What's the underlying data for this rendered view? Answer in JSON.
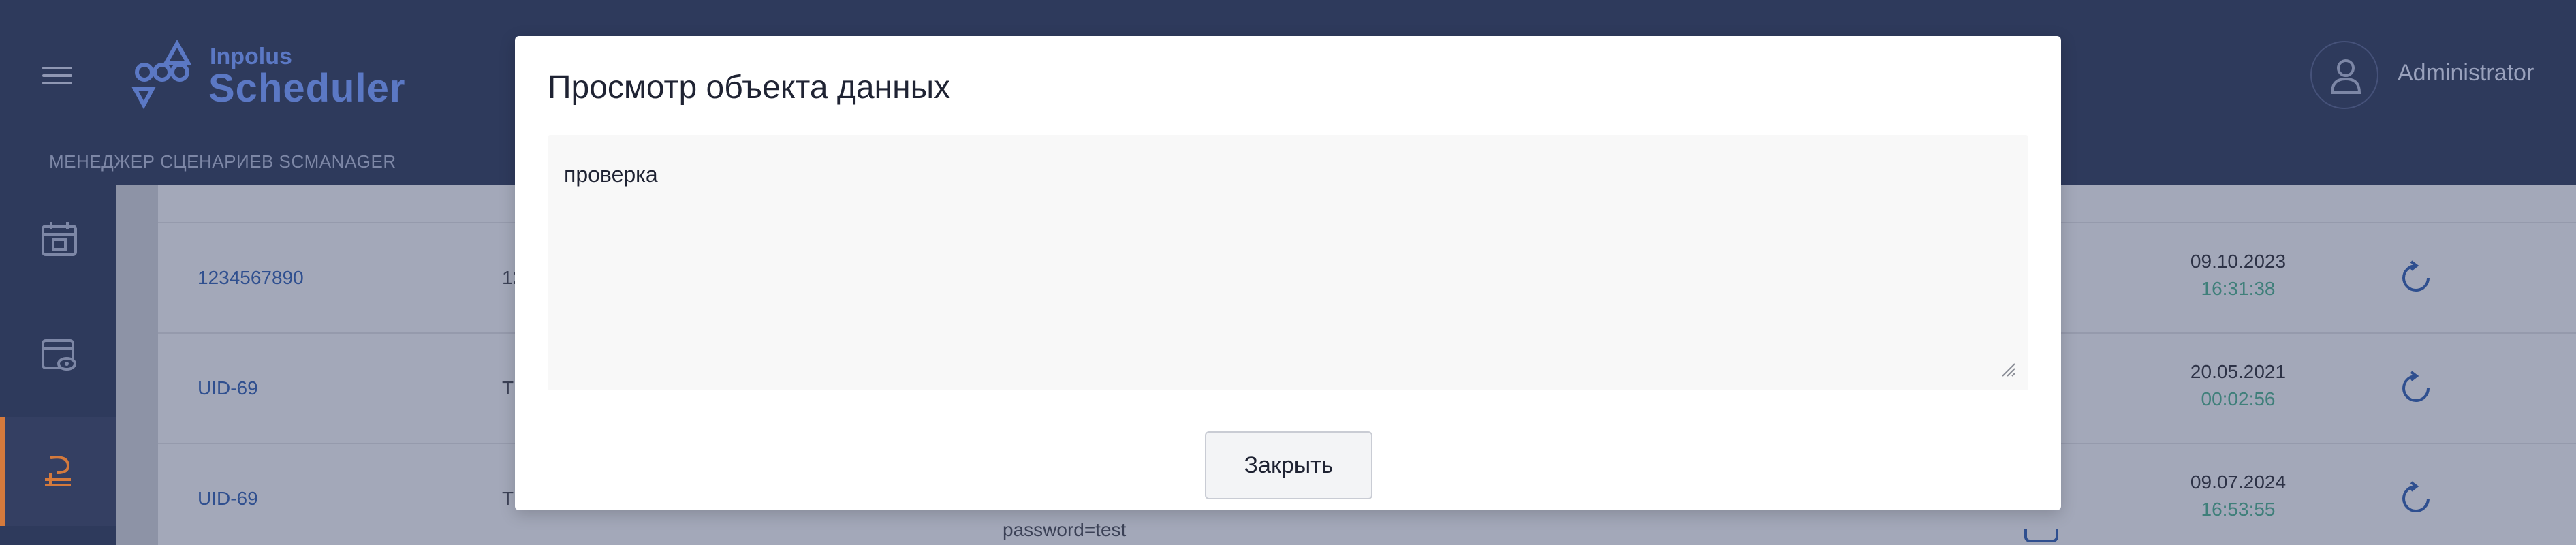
{
  "app": {
    "logo_small": "Inpolus",
    "logo_big": "Scheduler",
    "subtitle": "МЕНЕДЖЕР СЦЕНАРИЕВ SCMANAGER",
    "user_name": "Administrator"
  },
  "sidebar": {
    "items": [
      {
        "icon": "calendar-icon",
        "active": false
      },
      {
        "icon": "calendar-view-icon",
        "active": false
      },
      {
        "icon": "data-objects-icon",
        "active": true
      }
    ]
  },
  "table": {
    "rows": [
      {
        "id": "1234567890",
        "col2": "12",
        "date": "09.10.2023",
        "time": "16:31:38"
      },
      {
        "id": "UID-69",
        "col2": "T",
        "date": "20.05.2021",
        "time": "00:02:56"
      },
      {
        "id": "UID-69",
        "col2": "T",
        "param": "password=test",
        "date": "09.07.2024",
        "time": "16:53:55"
      }
    ]
  },
  "modal": {
    "title": "Просмотр объекта данных",
    "content": "проверка",
    "close_label": "Закрыть"
  },
  "colors": {
    "header_bg": "#2e3a5c",
    "accent": "#d57a3c",
    "link": "#2f4f8f",
    "logo": "#5b78c4"
  }
}
